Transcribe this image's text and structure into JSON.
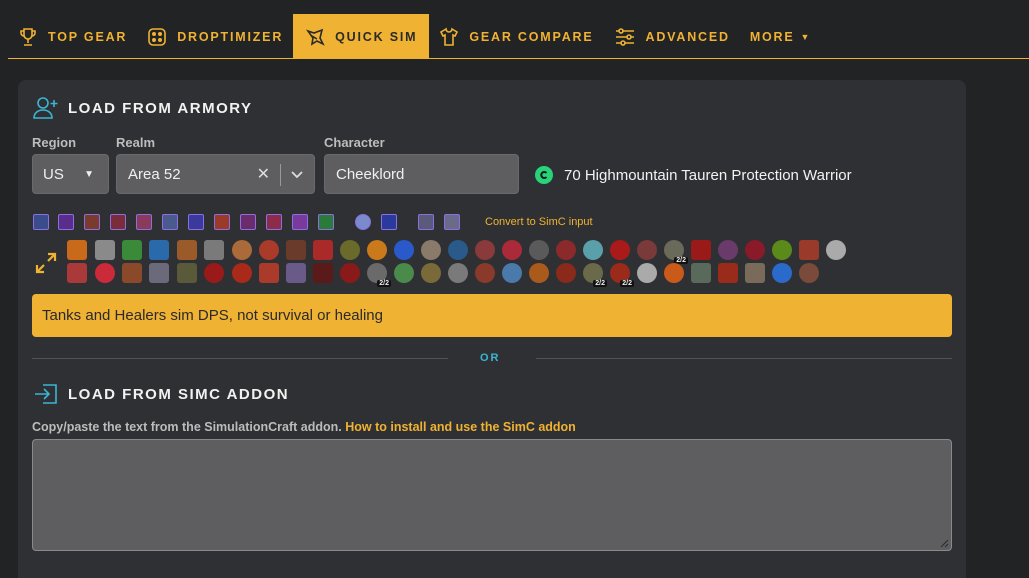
{
  "nav": {
    "items": [
      {
        "label": "TOP GEAR",
        "icon": "trophy-icon",
        "active": false
      },
      {
        "label": "DROPTIMIZER",
        "icon": "dice-icon",
        "active": false
      },
      {
        "label": "QUICK SIM",
        "icon": "quick-sim-icon",
        "active": true
      },
      {
        "label": "GEAR COMPARE",
        "icon": "shirt-icon",
        "active": false
      },
      {
        "label": "ADVANCED",
        "icon": "sliders-icon",
        "active": false
      },
      {
        "label": "MORE",
        "icon": "caret-down-icon",
        "active": false
      }
    ]
  },
  "armory": {
    "title": "LOAD FROM ARMORY",
    "icon": "add-user-icon",
    "region_label": "Region",
    "region_value": "US",
    "realm_label": "Realm",
    "realm_value": "Area 52",
    "character_label": "Character",
    "character_value": "Cheeklord",
    "character_info": "70 Highmountain Tauren Protection Warrior",
    "status_icon": "check-circle-icon",
    "convert_link": "Convert to SimC input",
    "expand_icon": "expand-arrows-icon"
  },
  "talent_badges": {
    "row1_a": "2/2",
    "row2_a": "2/2",
    "row2_b": "2/2",
    "row2_c": "2/2"
  },
  "warning": "Tanks and Healers sim DPS, not survival or healing",
  "divider": "OR",
  "simc": {
    "title": "LOAD FROM SIMC ADDON",
    "icon": "import-icon",
    "help_text": "Copy/paste the text from the SimulationCraft addon.",
    "help_link": "How to install and use the SimC addon",
    "textarea_value": ""
  },
  "colors": {
    "accent": "#f0b232",
    "background": "#222325",
    "panel": "#2f3033",
    "field": "#5e5e60",
    "success": "#27d47a",
    "divider_text": "#3ab6d4"
  }
}
